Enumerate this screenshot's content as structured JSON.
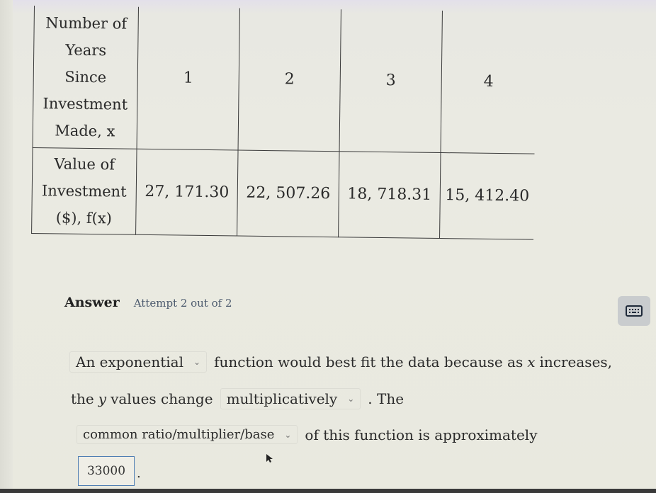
{
  "table": {
    "row_x_label": [
      "Number of",
      "Years",
      "Since",
      "Investment",
      "Made, x"
    ],
    "row_fx_label": [
      "Value of",
      "Investment",
      "($), f(x)"
    ],
    "x_values": [
      "1",
      "2",
      "3",
      "4"
    ],
    "fx_values": [
      "27, 171.30",
      "22, 507.26",
      "18, 718.31",
      "15, 412.40"
    ]
  },
  "answer": {
    "label": "Answer",
    "attempt": "Attempt 2 out of 2",
    "keyboard_icon": "keyboard-icon"
  },
  "sentence": {
    "select1_value": "An exponential",
    "text1": "function would best fit the data because as",
    "var_x": "x",
    "text2": "increases,",
    "text3": "the",
    "var_y": "y",
    "text4": "values change",
    "select2_value": "multiplicatively",
    "text5": ". The",
    "select3_value": "common ratio/multiplier/base",
    "text6": "of this function is approximately",
    "input_value": "33000",
    "text7": "."
  },
  "icons": {
    "caret": "⌄"
  }
}
